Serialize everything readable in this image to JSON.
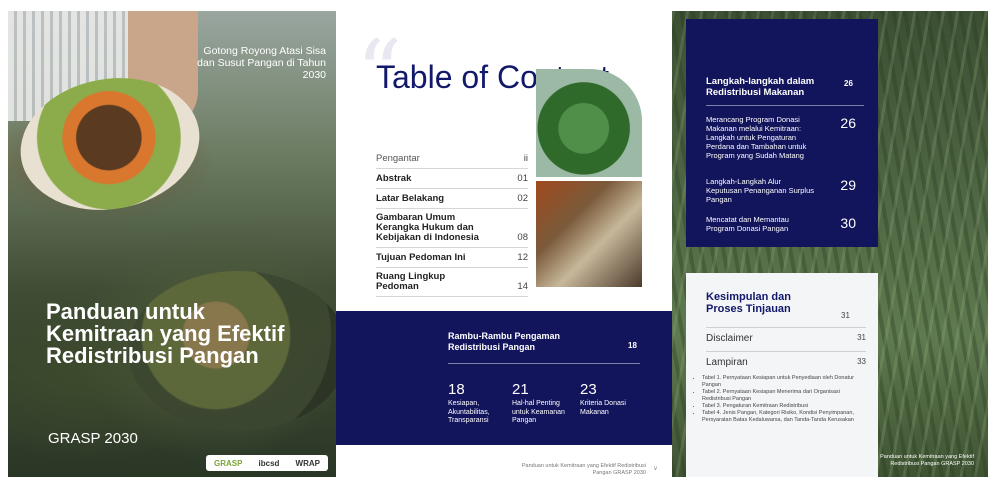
{
  "cover": {
    "tagline": "Gotong Royong Atasi Sisa dan Susut Pangan di Tahun 2030",
    "title": "Panduan untuk Kemitraan yang Efektif Redistribusi Pangan",
    "subtitle": "GRASP 2030",
    "logos": [
      "GRASP",
      "ibcsd",
      "WRAP"
    ]
  },
  "toc_page": {
    "title": "Table of Content",
    "items": [
      {
        "label": "Pengantar",
        "page": "ii",
        "style": "plain"
      },
      {
        "label": "Abstrak",
        "page": "01",
        "style": "bold"
      },
      {
        "label": "Latar Belakang",
        "page": "02",
        "style": "bold"
      },
      {
        "label": "Gambaran Umum Kerangka Hukum dan Kebijakan di Indonesia",
        "page": "08",
        "style": "bold"
      },
      {
        "label": "Tujuan Pedoman Ini",
        "page": "12",
        "style": "bold"
      },
      {
        "label": "Ruang Lingkup Pedoman",
        "page": "14",
        "style": "bold"
      }
    ],
    "band": {
      "title": "Rambu-Rambu Pengaman Redistribusi Pangan",
      "page": "18",
      "stats": [
        {
          "num": "18",
          "label": "Kesiapan, Akuntabilitas, Transparansi"
        },
        {
          "num": "21",
          "label": "Hal-hal Penting untuk Keamanan Pangan"
        },
        {
          "num": "23",
          "label": "Kriteria Donasi Makanan"
        }
      ]
    },
    "footer": "Panduan untuk Kemitraan yang Efektif Redistribusi Pangan GRASP 2030",
    "footer_page": "v"
  },
  "wheat_page": {
    "navy": {
      "heading": "Langkah-langkah dalam Redistribusi Makanan",
      "heading_page": "26",
      "items": [
        {
          "label": "Merancang Program Donasi Makanan melalui Kemitraan: Langkah untuk Pengaturan Perdana dan Tambahan untuk Program yang Sudah Matang",
          "page": "26"
        },
        {
          "label": "Langkah-Langkah Alur Keputusan Penanganan Surplus Pangan",
          "page": "29"
        },
        {
          "label": "Mencatat dan Memantau Program Donasi Pangan",
          "page": "30"
        }
      ]
    },
    "white": {
      "heading": "Kesimpulan dan Proses Tinjauan",
      "heading_page": "31",
      "rows": [
        {
          "label": "Disclaimer",
          "page": "31"
        },
        {
          "label": "Lampiran",
          "page": "33"
        }
      ],
      "bullets": [
        "Tabel 1. Pernyataan Kesiapan untuk Penyediaan oleh Donatur Pangan",
        "Tabel 2. Pernyataan Kesiapan Menerima dari Organisasi Redistribusi Pangan",
        "Tabel 3. Pengaturan Kemitraan Redistribusi",
        "Tabel 4. Jenis Pangan, Kategori Risiko, Kondisi Penyimpanan, Persyaratan Batas Kedaluwarsa, dan Tanda-Tanda Kerusakan"
      ]
    },
    "footer": "Panduan untuk Kemitraan yang Efektif Redistribusi Pangan GRASP 2030"
  }
}
